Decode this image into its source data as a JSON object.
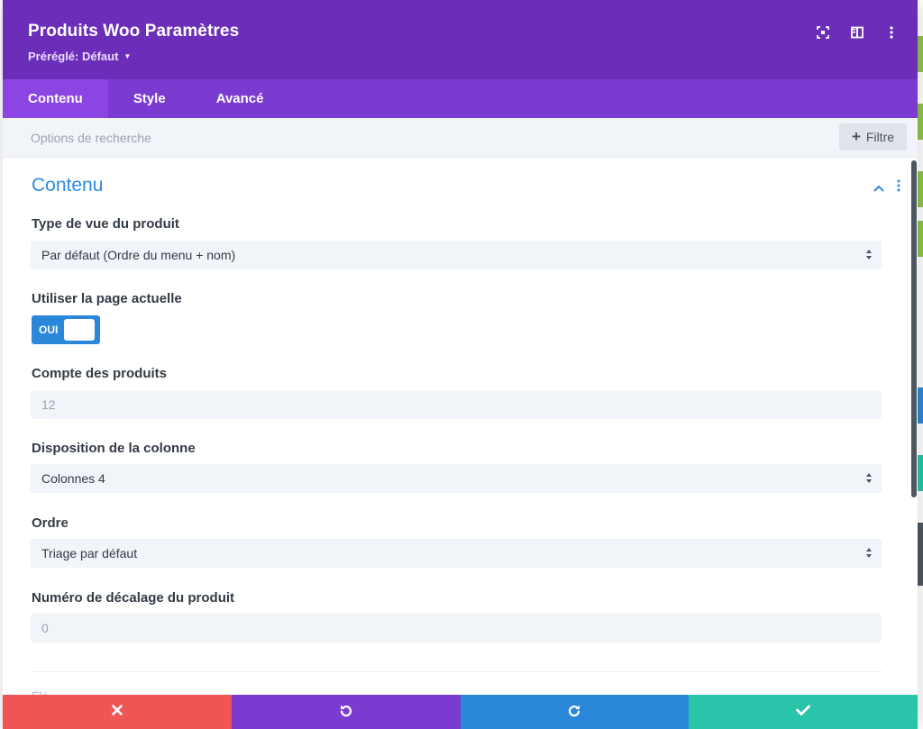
{
  "colors": {
    "header": "#6c2eb9",
    "tabs": "#7c3bd0",
    "tab_active": "#8b45e3",
    "accent_blue": "#2b87da",
    "cancel": "#ef5555",
    "undo": "#7c3bd0",
    "redo": "#2b87da",
    "save": "#29c4a9"
  },
  "header": {
    "title": "Produits Woo Paramètres",
    "preset_label": "Préréglé: Défaut",
    "icons": [
      "fullscreen-icon",
      "split-view-icon",
      "more-options-icon"
    ]
  },
  "tabs": [
    {
      "label": "Contenu",
      "active": true
    },
    {
      "label": "Style",
      "active": false
    },
    {
      "label": "Avancé",
      "active": false
    }
  ],
  "search": {
    "placeholder": "Options de recherche",
    "filter_label": "Filtre"
  },
  "section": {
    "title": "Contenu",
    "fields": {
      "view_type": {
        "label": "Type de vue du produit",
        "value": "Par défaut (Ordre du menu + nom)"
      },
      "use_current_page": {
        "label": "Utiliser la page actuelle",
        "toggle_text": "OUI",
        "on": true
      },
      "product_count": {
        "label": "Compte des produits",
        "placeholder": "12"
      },
      "column_layout": {
        "label": "Disposition de la colonne",
        "value": "Colonnes 4"
      },
      "order": {
        "label": "Ordre",
        "value": "Triage par défaut"
      },
      "offset": {
        "label": "Numéro de décalage du produit",
        "placeholder": "0"
      }
    }
  },
  "next_section_label": "Élé",
  "footer": {
    "buttons": [
      "cancel-icon",
      "undo-icon",
      "redo-icon",
      "save-icon"
    ]
  }
}
